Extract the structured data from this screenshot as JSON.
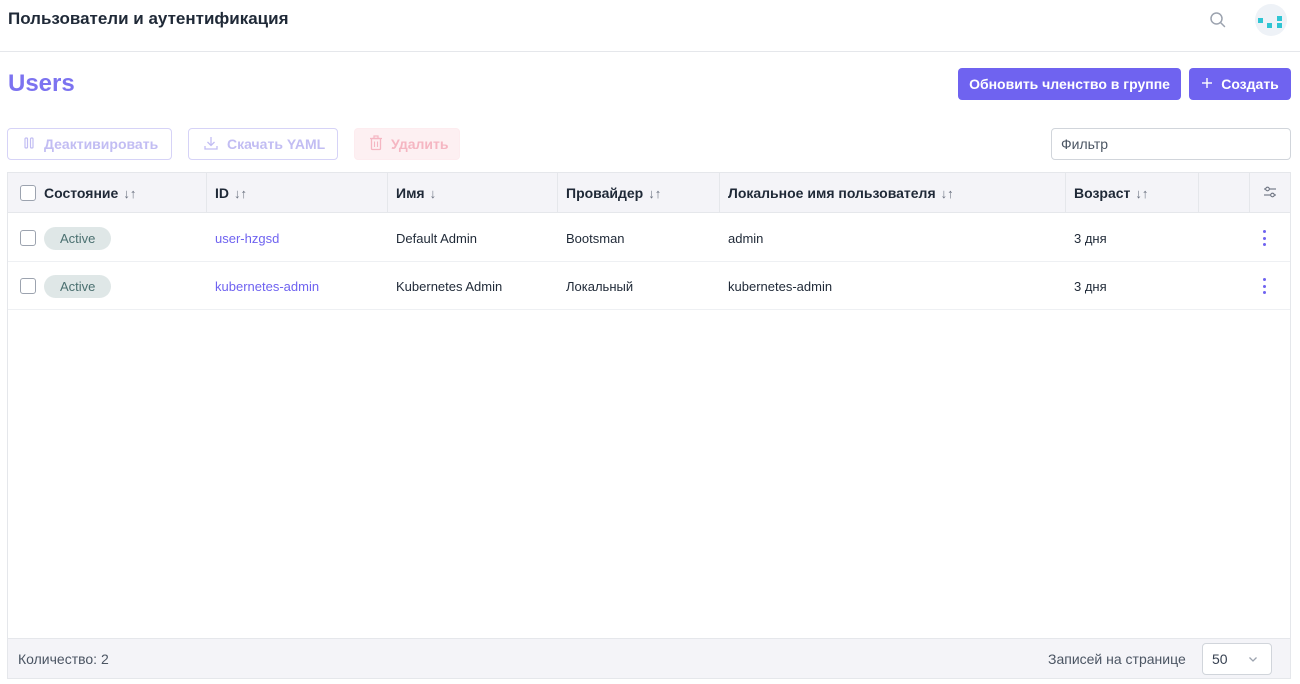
{
  "header": {
    "title": "Пользователи и аутентификация",
    "search_icon": "search-icon",
    "avatar_icon": "logo-avatar"
  },
  "page": {
    "title": "Users",
    "actions": {
      "group_label": "Обновить членство в группе",
      "create_label": "Создать",
      "create_icon": "plus-icon"
    }
  },
  "toolbar": {
    "deactivate_label": "Деактивировать",
    "download_label": "Скачать YAML",
    "delete_label": "Удалить",
    "filter_placeholder": "Фильтр"
  },
  "table": {
    "columns": {
      "state": "Состояние",
      "id": "ID",
      "name": "Имя",
      "provider": "Провайдер",
      "local_username": "Локальное имя пользователя",
      "age": "Возраст"
    },
    "rows": [
      {
        "state": "Active",
        "id": "user-hzgsd",
        "name": "Default Admin",
        "provider": "Bootsman",
        "local_username": "admin",
        "age": "3 дня"
      },
      {
        "state": "Active",
        "id": "kubernetes-admin",
        "name": "Kubernetes Admin",
        "provider": "Локальный",
        "local_username": "kubernetes-admin",
        "age": "3 дня"
      }
    ]
  },
  "footer": {
    "count_label": "Количество: 2",
    "per_page_label": "Записей на странице",
    "per_page_value": "50"
  },
  "colors": {
    "accent": "#6f63f0",
    "title_accent": "#7c73f0",
    "badge_bg": "#dfe7e7",
    "badge_text": "#4b7070",
    "logo": "#2fc5d3"
  }
}
